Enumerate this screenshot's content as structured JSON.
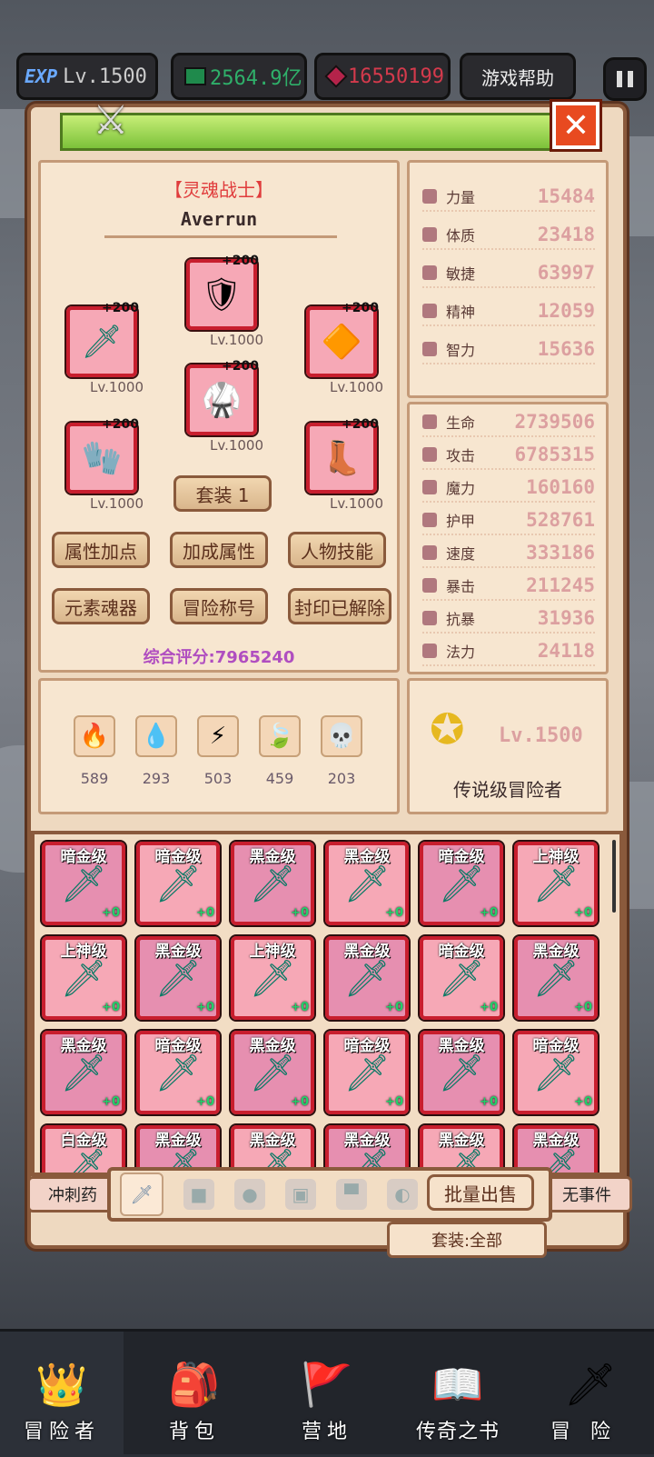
{
  "top": {
    "exp_label": "EXP",
    "level": "Lv.1500",
    "currency": "2564.9亿",
    "gems": "16550199",
    "help": "游戏帮助"
  },
  "char": {
    "class_name": "【灵魂战士】",
    "player_name": "Averrun",
    "score": "综合评分:7965240",
    "set_button": "套装 1",
    "equipment": [
      {
        "plus": "+200",
        "level": "Lv.1000"
      },
      {
        "plus": "+200",
        "level": "Lv.1000"
      },
      {
        "plus": "+200",
        "level": "Lv.1000"
      },
      {
        "plus": "+200",
        "level": "Lv.1000"
      },
      {
        "plus": "+200",
        "level": "Lv.1000"
      },
      {
        "plus": "+200",
        "level": "Lv.1000"
      }
    ],
    "buttons": [
      "属性加点",
      "加成属性",
      "人物技能",
      "元素魂器",
      "冒险称号",
      "封印已解除"
    ]
  },
  "elements": [
    {
      "icon": "fire",
      "count": "589"
    },
    {
      "icon": "water",
      "count": "293"
    },
    {
      "icon": "lightning",
      "count": "503"
    },
    {
      "icon": "wind",
      "count": "459"
    },
    {
      "icon": "skull",
      "count": "203"
    }
  ],
  "attributes": [
    {
      "name": "力量",
      "value": "15484"
    },
    {
      "name": "体质",
      "value": "23418"
    },
    {
      "name": "敏捷",
      "value": "63997"
    },
    {
      "name": "精神",
      "value": "12059"
    },
    {
      "name": "智力",
      "value": "15636"
    }
  ],
  "combat": [
    {
      "name": "生命",
      "value": "2739506"
    },
    {
      "name": "攻击",
      "value": "6785315"
    },
    {
      "name": "魔力",
      "value": "160160"
    },
    {
      "name": "护甲",
      "value": "528761"
    },
    {
      "name": "速度",
      "value": "333186"
    },
    {
      "name": "暴击",
      "value": "211245"
    },
    {
      "name": "抗暴",
      "value": "31936"
    },
    {
      "name": "法力",
      "value": "24118"
    }
  ],
  "rank": {
    "level": "Lv.1500",
    "title": "传说级冒险者"
  },
  "inventory": [
    {
      "tier": "暗金级",
      "plus": "+0"
    },
    {
      "tier": "暗金级",
      "plus": "+0"
    },
    {
      "tier": "黑金级",
      "plus": "+0"
    },
    {
      "tier": "黑金级",
      "plus": "+0"
    },
    {
      "tier": "暗金级",
      "plus": "+0"
    },
    {
      "tier": "上神级",
      "plus": "+0"
    },
    {
      "tier": "上神级",
      "plus": "+0"
    },
    {
      "tier": "黑金级",
      "plus": "+0"
    },
    {
      "tier": "上神级",
      "plus": "+0"
    },
    {
      "tier": "黑金级",
      "plus": "+0"
    },
    {
      "tier": "暗金级",
      "plus": "+0"
    },
    {
      "tier": "黑金级",
      "plus": "+0"
    },
    {
      "tier": "黑金级",
      "plus": "+0"
    },
    {
      "tier": "暗金级",
      "plus": "+0"
    },
    {
      "tier": "黑金级",
      "plus": "+0"
    },
    {
      "tier": "暗金级",
      "plus": "+0"
    },
    {
      "tier": "黑金级",
      "plus": "+0"
    },
    {
      "tier": "暗金级",
      "plus": "+0"
    },
    {
      "tier": "白金级",
      "plus": ""
    },
    {
      "tier": "黑金级",
      "plus": ""
    },
    {
      "tier": "黑金级",
      "plus": ""
    },
    {
      "tier": "黑金级",
      "plus": ""
    },
    {
      "tier": "黑金级",
      "plus": ""
    },
    {
      "tier": "黑金级",
      "plus": ""
    }
  ],
  "inv_controls": {
    "batch_sell": "批量出售",
    "set_filter": "套装:全部"
  },
  "background": {
    "left_btn": "冲刺药",
    "right_btn": "无事件"
  },
  "nav": [
    {
      "label": "冒险者",
      "icon": "helmet-icon"
    },
    {
      "label": "背包",
      "icon": "backpack-icon"
    },
    {
      "label": "营地",
      "icon": "banner-icon"
    },
    {
      "label": "传奇之书",
      "icon": "book-icon"
    },
    {
      "label": "冒险",
      "icon": "sword-icon"
    }
  ],
  "colors": {
    "accent_red": "#c81e2e",
    "panel": "#eed9c0",
    "score": "#b04ec0",
    "stat_value": "#dca0a0"
  }
}
